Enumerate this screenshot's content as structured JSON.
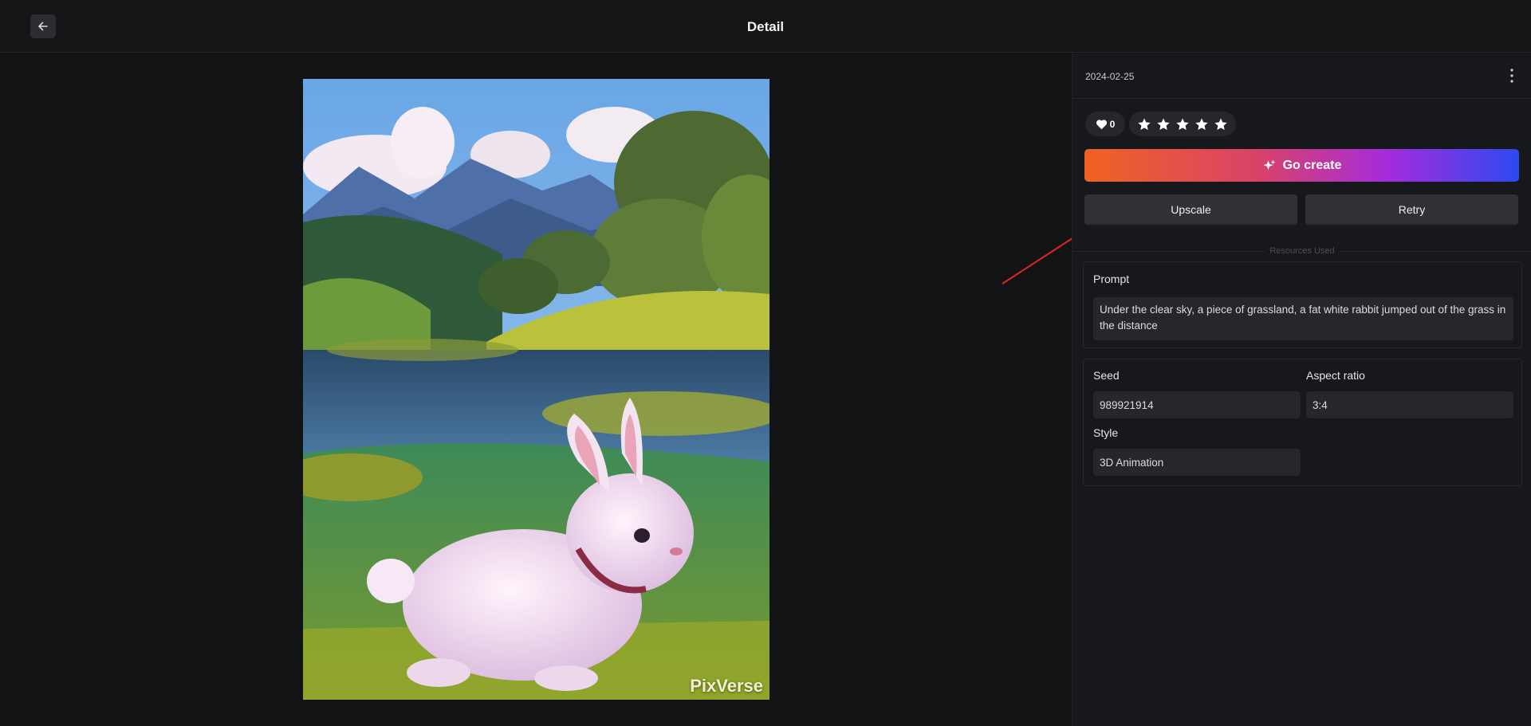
{
  "header": {
    "title": "Detail"
  },
  "panel": {
    "date": "2024-02-25",
    "likes": "0",
    "go_create_label": "Go create",
    "upscale_label": "Upscale",
    "retry_label": "Retry",
    "resources_label": "Resources Used",
    "prompt": {
      "label": "Prompt",
      "value": "Under the clear sky, a piece of grassland, a fat white rabbit jumped out of the grass in the distance"
    },
    "params": {
      "seed_label": "Seed",
      "seed_value": "989921914",
      "aspect_label": "Aspect ratio",
      "aspect_value": "3:4",
      "style_label": "Style",
      "style_value": "3D Animation"
    }
  },
  "image": {
    "watermark": "PixVerse"
  },
  "icons": {
    "back": "arrow-left-icon",
    "more": "more-vertical-icon",
    "like": "heart-icon",
    "star": "star-icon",
    "create": "sparkle-icon"
  },
  "colors": {
    "background": "#121315",
    "panel": "#17181b",
    "button": "#2f3136",
    "gradient": [
      "#f06322",
      "#d8426a",
      "#a42cdc",
      "#2d49f0"
    ],
    "annotation_arrow": "#e0261e"
  }
}
